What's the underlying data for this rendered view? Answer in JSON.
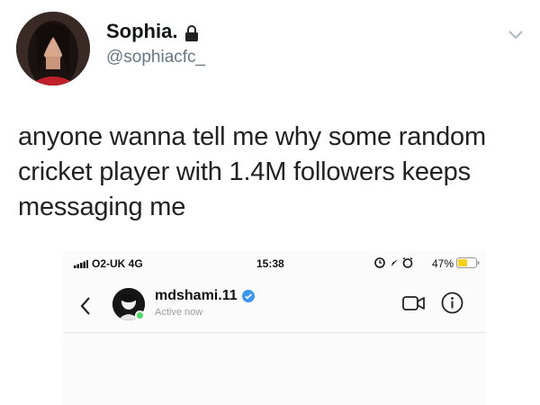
{
  "tweet": {
    "display_name": "Sophia.",
    "handle": "@sophiacfc_",
    "text": "anyone wanna tell me why some random cricket player with 1.4M followers keeps messaging me"
  },
  "phone_status": {
    "carrier": "O2-UK  4G",
    "time": "15:38",
    "battery": "47%"
  },
  "dm": {
    "username": "mdshami.11",
    "status": "Active now"
  },
  "colors": {
    "verified": "#3897f0",
    "active": "#4cd964",
    "battery": "#f7d21b"
  },
  "icons": [
    "lock-icon",
    "chevron-down-icon",
    "signal-icon",
    "alarm-icon",
    "location-icon",
    "battery-icon",
    "back-arrow-icon",
    "verified-icon",
    "video-call-icon",
    "info-icon"
  ]
}
